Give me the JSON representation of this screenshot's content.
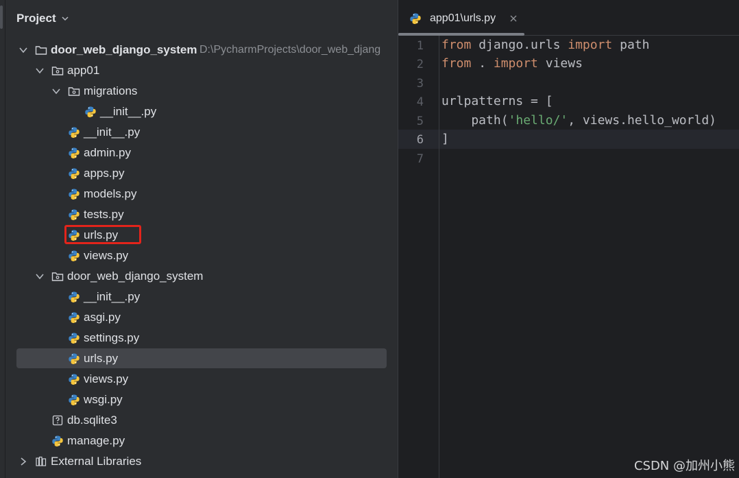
{
  "project_panel": {
    "title": "Project",
    "tree": [
      {
        "label": "door_web_django_system",
        "path": "D:\\PycharmProjects\\door_web_djang",
        "type": "root-folder"
      },
      {
        "label": "app01",
        "type": "package"
      },
      {
        "label": "migrations",
        "type": "package"
      },
      {
        "label": "__init__.py",
        "type": "python"
      },
      {
        "label": "__init__.py",
        "type": "python"
      },
      {
        "label": "admin.py",
        "type": "python"
      },
      {
        "label": "apps.py",
        "type": "python"
      },
      {
        "label": "models.py",
        "type": "python"
      },
      {
        "label": "tests.py",
        "type": "python"
      },
      {
        "label": "urls.py",
        "type": "python"
      },
      {
        "label": "views.py",
        "type": "python"
      },
      {
        "label": "door_web_django_system",
        "type": "package"
      },
      {
        "label": "__init__.py",
        "type": "python"
      },
      {
        "label": "asgi.py",
        "type": "python"
      },
      {
        "label": "settings.py",
        "type": "python"
      },
      {
        "label": "urls.py",
        "type": "python"
      },
      {
        "label": "views.py",
        "type": "python"
      },
      {
        "label": "wsgi.py",
        "type": "python"
      },
      {
        "label": "db.sqlite3",
        "type": "unknown-file"
      },
      {
        "label": "manage.py",
        "type": "python"
      },
      {
        "label": "External Libraries",
        "type": "library"
      }
    ]
  },
  "editor": {
    "tab_label": "app01\\urls.py",
    "line_numbers": [
      "1",
      "2",
      "3",
      "4",
      "5",
      "6",
      "7"
    ],
    "code": {
      "l1_kw1": "from",
      "l1_mid": " django.urls ",
      "l1_kw2": "import",
      "l1_end": " path",
      "l2_kw1": "from",
      "l2_mid": " . ",
      "l2_kw2": "import",
      "l2_end": " views",
      "l4": "urlpatterns = [",
      "l5_start": "    path(",
      "l5_str": "'hello/'",
      "l5_end": ", views.hello_world)",
      "l6": "]"
    }
  },
  "watermark": "CSDN @加州小熊",
  "colors": {
    "keyword": "#cf8e6d",
    "string": "#6aab73",
    "highlight": "#e3241b"
  }
}
